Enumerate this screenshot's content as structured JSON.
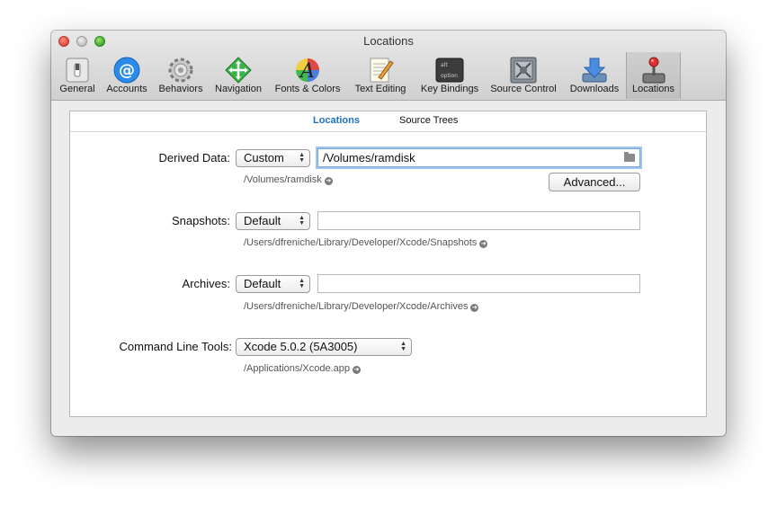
{
  "window": {
    "title": "Locations"
  },
  "toolbar": [
    {
      "label": "General",
      "icon": "general-switch-icon"
    },
    {
      "label": "Accounts",
      "icon": "at-sign-icon"
    },
    {
      "label": "Behaviors",
      "icon": "gears-icon"
    },
    {
      "label": "Navigation",
      "icon": "navigation-arrows-icon"
    },
    {
      "label": "Fonts & Colors",
      "icon": "font-color-icon"
    },
    {
      "label": "Text Editing",
      "icon": "notepad-pencil-icon"
    },
    {
      "label": "Key Bindings",
      "icon": "alt-option-keys-icon"
    },
    {
      "label": "Source Control",
      "icon": "vault-icon"
    },
    {
      "label": "Downloads",
      "icon": "download-icon"
    },
    {
      "label": "Locations",
      "icon": "joystick-icon",
      "active": true
    }
  ],
  "tabs": {
    "locations": "Locations",
    "source_trees": "Source Trees",
    "selected": "Locations"
  },
  "derived_data": {
    "label": "Derived Data:",
    "mode": "Custom",
    "path_value": "/Volumes/ramdisk",
    "resolved_path": "/Volumes/ramdisk",
    "advanced_button": "Advanced..."
  },
  "snapshots": {
    "label": "Snapshots:",
    "mode": "Default",
    "path_value": "",
    "resolved_path": "/Users/dfreniche/Library/Developer/Xcode/Snapshots"
  },
  "archives": {
    "label": "Archives:",
    "mode": "Default",
    "path_value": "",
    "resolved_path": "/Users/dfreniche/Library/Developer/Xcode/Archives"
  },
  "command_line_tools": {
    "label": "Command Line Tools:",
    "value": "Xcode 5.0.2 (5A3005)",
    "resolved_path": "/Applications/Xcode.app"
  },
  "colors": {
    "accent": "#1f6fc5",
    "focus_ring": "#9fc4ee"
  }
}
